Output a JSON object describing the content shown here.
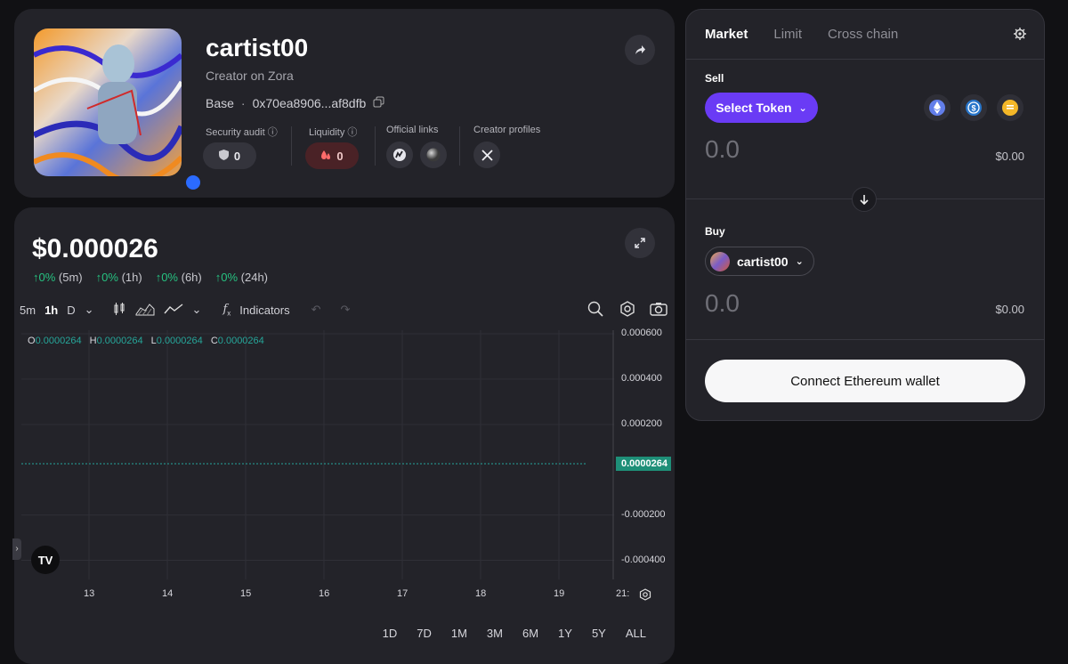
{
  "profile": {
    "name": "cartist00",
    "subtitle": "Creator on Zora",
    "chain": "Base",
    "separator": "·",
    "address": "0x70ea8906...af8dfb",
    "security_label": "Security audit",
    "security_value": "0",
    "liquidity_label": "Liquidity",
    "liquidity_value": "0",
    "official_links_label": "Official links",
    "creator_profiles_label": "Creator profiles"
  },
  "chart": {
    "price": "$0.000026",
    "changes": [
      {
        "value": "↑0%",
        "period": "(5m)"
      },
      {
        "value": "↑0%",
        "period": "(1h)"
      },
      {
        "value": "↑0%",
        "period": "(6h)"
      },
      {
        "value": "↑0%",
        "period": "(24h)"
      }
    ],
    "toolbar": {
      "interval_5m": "5m",
      "interval_1h": "1h",
      "interval_d": "D",
      "indicators_label": "Indicators"
    },
    "ohlc": {
      "o_label": "O",
      "o_value": "0.0000264",
      "h_label": "H",
      "h_value": "0.0000264",
      "l_label": "L",
      "l_value": "0.0000264",
      "c_label": "C",
      "c_value": "0.0000264"
    },
    "y_ticks": [
      "0.000600",
      "0.000400",
      "0.000200",
      "-0.000200",
      "-0.000400"
    ],
    "last_price_label": "0.0000264",
    "x_ticks": [
      "13",
      "14",
      "15",
      "16",
      "17",
      "18",
      "19",
      "21:"
    ],
    "ranges": [
      "1D",
      "7D",
      "1M",
      "3M",
      "6M",
      "1Y",
      "5Y",
      "ALL"
    ],
    "logo_text": "TV"
  },
  "chart_data": {
    "type": "line",
    "x": [
      "13",
      "14",
      "15",
      "16",
      "17",
      "18",
      "19",
      "21:"
    ],
    "series": [
      {
        "values": [
          2.64e-05,
          2.64e-05,
          2.64e-05,
          2.64e-05,
          2.64e-05,
          2.64e-05,
          2.64e-05,
          2.64e-05
        ]
      }
    ],
    "ylim": [
      -0.0005,
      0.0006
    ],
    "grid": true,
    "line_color": "#26a69a"
  },
  "swap": {
    "tabs": [
      "Market",
      "Limit",
      "Cross chain"
    ],
    "sell_label": "Sell",
    "select_token_label": "Select Token",
    "sell_amount": "0.0",
    "sell_usd": "$0.00",
    "buy_label": "Buy",
    "buy_token": "cartist00",
    "buy_amount": "0.0",
    "buy_usd": "$0.00",
    "connect_label": "Connect Ethereum wallet",
    "quick_tokens": [
      "eth-icon",
      "usdc-icon",
      "degen-icon"
    ]
  },
  "colors": {
    "accent": "#6a3bf5",
    "positive": "#26c281",
    "chart_line": "#26a69a",
    "liquidity_bg": "#4a2226"
  }
}
